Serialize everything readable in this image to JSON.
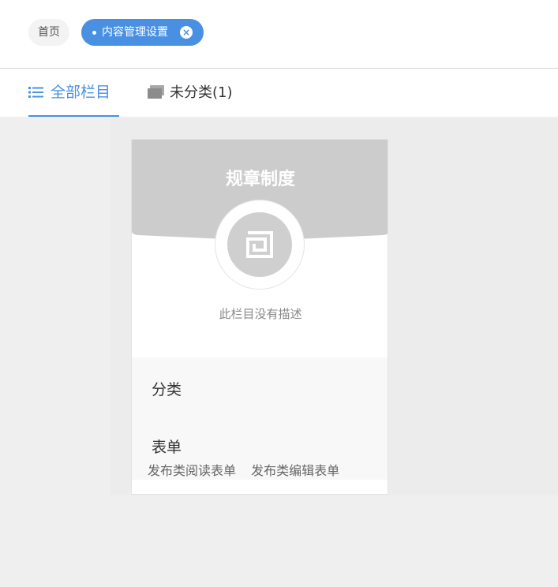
{
  "breadcrumbs": {
    "home": "首页",
    "active": "内容管理设置",
    "close_icon": "close-icon"
  },
  "tabs": {
    "all": {
      "label": "全部栏目",
      "icon": "list-icon",
      "active": true
    },
    "uncategorized": {
      "label": "未分类(1)",
      "icon": "folder-icon",
      "active": false
    }
  },
  "card": {
    "title": "规章制度",
    "logo_icon": "logo-icon",
    "description": "此栏目没有描述",
    "section_category": "分类",
    "section_form": "表单",
    "form_links": [
      "发布类阅读表单",
      "发布类编辑表单"
    ]
  },
  "colors": {
    "accent": "#4a90e2",
    "banner": "#cccccc",
    "page_bg": "#efefef"
  }
}
